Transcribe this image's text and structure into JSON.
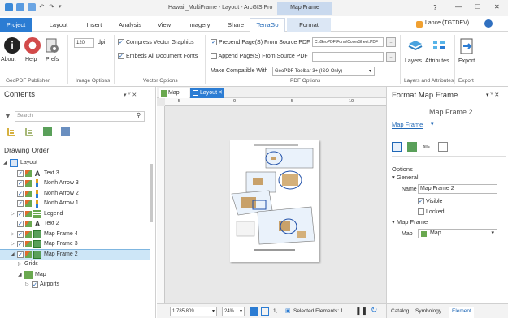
{
  "window": {
    "title": "Hawaii_MultiFrame - Layout - ArcGIS Pro",
    "context_tab": "Map Frame",
    "help": "?",
    "minimize": "—",
    "maximize": "☐",
    "close": "✕"
  },
  "user": {
    "name": "Lance (TGTDEV)"
  },
  "ribbon_tabs": [
    "Project",
    "Layout",
    "Insert",
    "Analysis",
    "View",
    "Imagery",
    "Share",
    "TerraGo",
    "Format"
  ],
  "ribbon": {
    "about": "About",
    "help": "Help",
    "prefs": "Prefs",
    "dpi_value": "120",
    "dpi_unit": "dpi",
    "compress": "Compress Vector Graphics",
    "embed": "Embeds All Document Fonts",
    "prepend": "Prepend Page(S) From Source PDF",
    "prepend_path": "C:\\GeoPDF\\Form\\CoverSheet.PDF",
    "append": "Append Page(S) From Source PDF",
    "compat_label": "Make Compatible With",
    "compat_value": "GeoPDF Toolbar 3+ (ISO Only)",
    "layers": "Layers",
    "attributes": "Attributes",
    "export": "Export",
    "group_publisher": "GeoPDF Publisher",
    "group_image": "Image Options",
    "group_vector": "Vector Options",
    "group_pdf": "PDF Options",
    "group_layers": "Layers and Attributes",
    "group_export": "Export"
  },
  "contents": {
    "title": "Contents",
    "pin": "▾ ⱽ ✕",
    "search_placeholder": "Search",
    "drawing_order": "Drawing Order",
    "items": [
      {
        "label": "Layout",
        "indent": 0,
        "type": "layout",
        "checked": false,
        "expanded": true
      },
      {
        "label": "Text 3",
        "indent": 1,
        "type": "text",
        "checked": true
      },
      {
        "label": "North Arrow 3",
        "indent": 1,
        "type": "north",
        "checked": true
      },
      {
        "label": "North Arrow 2",
        "indent": 1,
        "type": "north",
        "checked": true
      },
      {
        "label": "North Arrow 1",
        "indent": 1,
        "type": "north",
        "checked": true
      },
      {
        "label": "Legend",
        "indent": 1,
        "type": "legend",
        "checked": true,
        "expander": true
      },
      {
        "label": "Text 2",
        "indent": 1,
        "type": "text",
        "checked": true
      },
      {
        "label": "Map Frame 4",
        "indent": 1,
        "type": "frame",
        "checked": true,
        "expander": true
      },
      {
        "label": "Map Frame 3",
        "indent": 1,
        "type": "frame",
        "checked": true,
        "expander": true
      },
      {
        "label": "Map Frame 2",
        "indent": 1,
        "type": "frame",
        "checked": true,
        "expanded": true,
        "selected": true
      },
      {
        "label": "Grids",
        "indent": 2,
        "type": "plain",
        "checked": false,
        "expander": true
      },
      {
        "label": "Map",
        "indent": 2,
        "type": "map",
        "checked": false,
        "expanded": true
      },
      {
        "label": "Airports",
        "indent": 3,
        "type": "plain",
        "checked": true,
        "expander": true
      }
    ]
  },
  "view_tabs": {
    "map": "Map",
    "layout": "Layout"
  },
  "ruler": {
    "a": "-5",
    "b": "0",
    "c": "5",
    "d": "10"
  },
  "status": {
    "scale": "1:785,809",
    "zoom": "24%",
    "page": "1,",
    "selected": "Selected Elements: 1"
  },
  "format": {
    "title": "Format Map Frame",
    "subtitle": "Map Frame 2",
    "dropdown": "Map Frame",
    "options": "Options",
    "general": "General",
    "name_label": "Name",
    "name_value": "Map Frame 2",
    "visible": "Visible",
    "locked": "Locked",
    "map_frame": "Map Frame",
    "map_label": "Map",
    "map_value": "Map",
    "tabs": [
      "Catalog",
      "Symbology",
      "Element"
    ]
  },
  "colors": {
    "accent": "#2b7cd3",
    "selected_row": "#cde6f7",
    "context_tab": "#c9d9ee"
  }
}
